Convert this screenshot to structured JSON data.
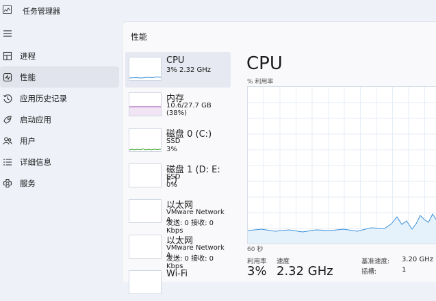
{
  "app": {
    "title": "任务管理器"
  },
  "nav": [
    {
      "label": "进程",
      "icon": "processes-icon"
    },
    {
      "label": "性能",
      "icon": "performance-icon",
      "active": true
    },
    {
      "label": "应用历史记录",
      "icon": "app-history-icon"
    },
    {
      "label": "启动应用",
      "icon": "startup-apps-icon"
    },
    {
      "label": "用户",
      "icon": "users-icon"
    },
    {
      "label": "详细信息",
      "icon": "details-icon"
    },
    {
      "label": "服务",
      "icon": "services-icon"
    }
  ],
  "page": {
    "title": "性能"
  },
  "resources": [
    {
      "name": "CPU",
      "line1": "3%  2.32 GHz",
      "line2": "",
      "thumb_color": "#3a8fd9",
      "selected": true
    },
    {
      "name": "内存",
      "line1": "10.6/27.7 GB (38%)",
      "line2": "",
      "thumb_color": "#9a49b3"
    },
    {
      "name": "磁盘 0 (C:)",
      "line1": "SSD",
      "line2": "3%",
      "thumb_color": "#4caa3f"
    },
    {
      "name": "磁盘 1 (D: E: F:)",
      "line1": "SSD",
      "line2": "0%",
      "thumb_color": "#4caa3f"
    },
    {
      "name": "以太网",
      "line1": "VMware Network A...",
      "line2": "发送: 0  接收: 0 Kbps",
      "thumb_color": "#b86a1e"
    },
    {
      "name": "以太网",
      "line1": "VMware Network A...",
      "line2": "发送: 0  接收: 0 Kbps",
      "thumb_color": "#b86a1e"
    },
    {
      "name": "Wi-Fi",
      "line1": "",
      "line2": "",
      "thumb_color": "#b86a1e"
    }
  ],
  "detail": {
    "title": "CPU",
    "graph_label": "% 利用率",
    "seconds_label": "60 秒",
    "stats": {
      "utilization_label": "利用率",
      "utilization_value": "3%",
      "speed_label": "速度",
      "speed_value": "2.32 GHz",
      "base_speed_label": "基准速度:",
      "base_speed_value": "3.20 GHz",
      "sockets_label": "插槽:",
      "sockets_value": "1"
    }
  }
}
